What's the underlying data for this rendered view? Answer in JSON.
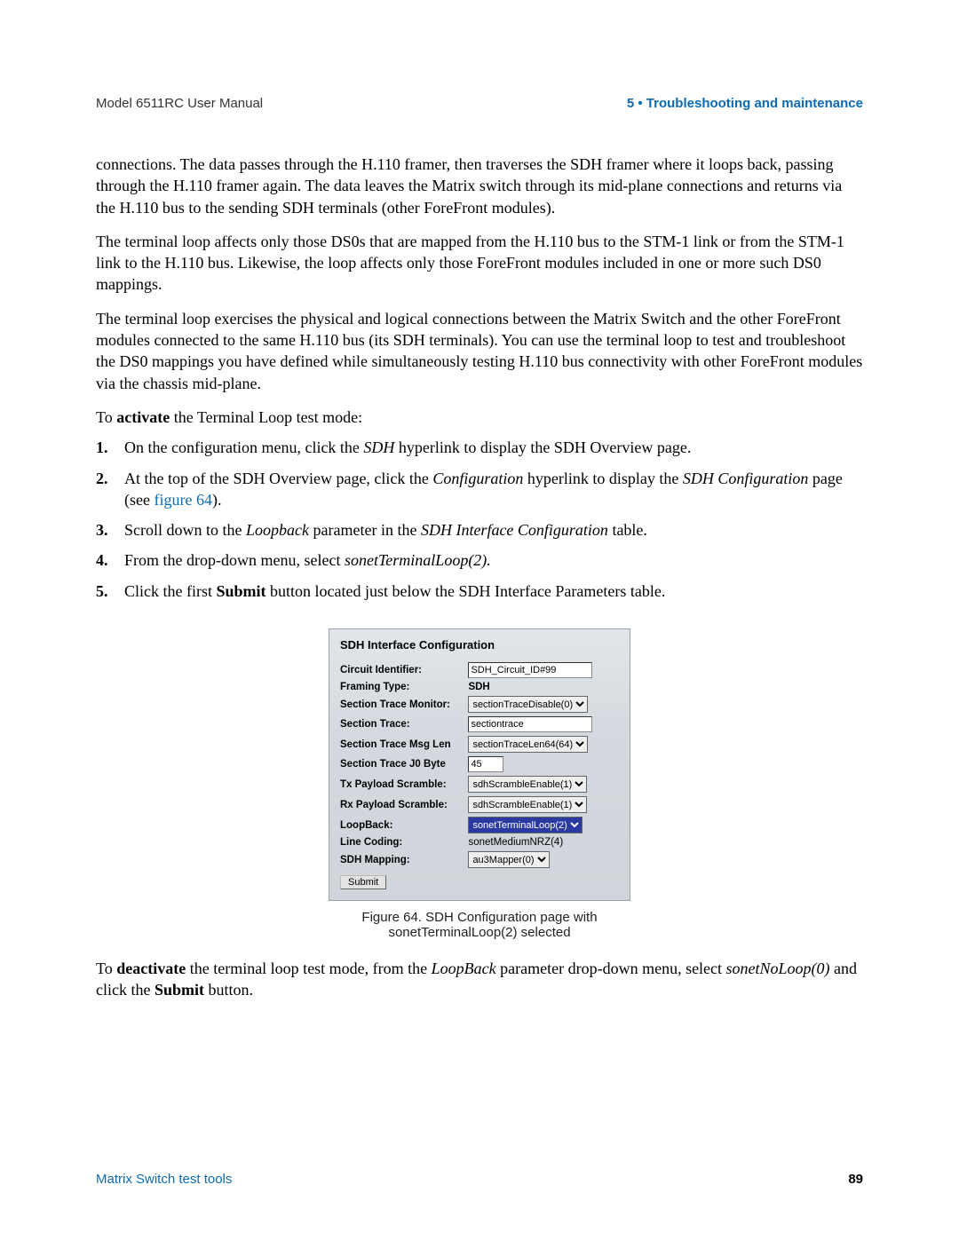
{
  "header": {
    "left": "Model 6511RC User Manual",
    "right": "5 • Troubleshooting and maintenance"
  },
  "paragraphs": {
    "p1": "connections. The data passes through the H.110 framer, then traverses the SDH framer where it loops back, passing through the H.110 framer again. The data leaves the Matrix switch through its mid-plane connections and returns via the H.110 bus to the sending SDH terminals (other ForeFront modules).",
    "p2": "The terminal loop affects only those DS0s that are mapped from the H.110 bus to the STM-1 link or from the STM-1 link to the H.110 bus. Likewise, the loop affects only those ForeFront modules included in one or more such DS0 mappings.",
    "p3": "The terminal loop exercises the physical and logical connections between the Matrix Switch and the other ForeFront modules connected to the same H.110 bus (its SDH terminals). You can use the terminal loop to test and troubleshoot the DS0 mappings you have defined while simultaneously testing H.110 bus connectivity with other ForeFront modules via the chassis mid-plane.",
    "activate_pre": "To ",
    "activate_bold": "activate",
    "activate_post": " the Terminal Loop test mode:",
    "deact_pre": "To ",
    "deact_bold": "deactivate",
    "deact_mid": " the terminal loop test mode, from the ",
    "deact_loopback": "LoopBack",
    "deact_mid2": " parameter drop-down menu, select ",
    "deact_sonet": "sonetNoLoop(0)",
    "deact_mid3": " and click the ",
    "deact_submit": "Submit",
    "deact_end": " button."
  },
  "steps": {
    "s1_pre": "On the configuration menu, click the ",
    "s1_sdh": "SDH",
    "s1_post": " hyperlink to display the SDH Overview page.",
    "s2_pre": "At the top of the SDH Overview page, click the ",
    "s2_cfg": "Configuration",
    "s2_mid": " hyperlink to display the ",
    "s2_sdhcfg": "SDH Configuration",
    "s2_post": " page (see ",
    "s2_link": "figure 64",
    "s2_close": ").",
    "s3_pre": "Scroll down to the ",
    "s3_lb": "Loopback",
    "s3_mid": " parameter in the ",
    "s3_table": "SDH Interface Configuration",
    "s3_post": " table.",
    "s4_pre": "From the drop-down menu, select ",
    "s4_val": "sonetTerminalLoop(2).",
    "s5_pre": "Click the first ",
    "s5_submit": "Submit",
    "s5_post": " button located just below the SDH Interface Parameters table."
  },
  "nums": {
    "n1": "1.",
    "n2": "2.",
    "n3": "3.",
    "n4": "4.",
    "n5": "5."
  },
  "config": {
    "title": "SDH Interface Configuration",
    "labels": {
      "circuit": "Circuit Identifier:",
      "framing": "Framing Type:",
      "stmon": "Section Trace Monitor:",
      "strace": "Section Trace:",
      "stmsglen": "Section Trace Msg Len",
      "stj0": "Section Trace J0 Byte",
      "txps": "Tx Payload Scramble:",
      "rxps": "Rx Payload Scramble:",
      "loop": "LoopBack:",
      "linecode": "Line Coding:",
      "sdhmap": "SDH Mapping:"
    },
    "values": {
      "circuit": "SDH_Circuit_ID#99",
      "framing": "SDH",
      "stmon": "sectionTraceDisable(0)",
      "strace": "sectiontrace",
      "stmsglen": "sectionTraceLen64(64)",
      "stj0": "45",
      "txps": "sdhScrambleEnable(1)",
      "rxps": "sdhScrambleEnable(1)",
      "loop": "sonetTerminalLoop(2)",
      "linecode": "sonetMediumNRZ(4)",
      "sdhmap": "au3Mapper(0)"
    },
    "submit": "Submit"
  },
  "figcaption": "Figure 64. SDH Configuration page with sonetTerminalLoop(2) selected",
  "footer": {
    "left": "Matrix Switch test tools",
    "page": "89"
  }
}
